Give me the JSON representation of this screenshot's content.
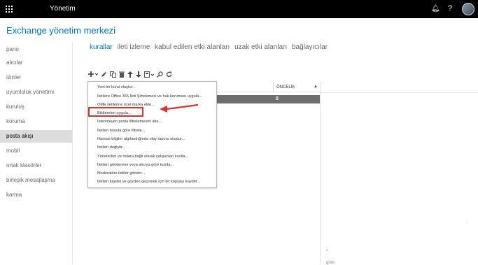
{
  "topbar": {
    "app_title": "Yönetim",
    "notifications_glyph": "🔔︎",
    "help_glyph": "?"
  },
  "center_title": "Exchange yönetim merkezi",
  "leftnav": {
    "items": [
      {
        "label": "pano"
      },
      {
        "label": "alıcılar"
      },
      {
        "label": "izinler"
      },
      {
        "label": "uyumluluk yönetimi"
      },
      {
        "label": "kuruluş"
      },
      {
        "label": "koruma"
      },
      {
        "label": "posta akışı",
        "active": true
      },
      {
        "label": "mobil"
      },
      {
        "label": "ortak klasörler"
      },
      {
        "label": "birleşik mesajlaşma"
      },
      {
        "label": "karma"
      }
    ]
  },
  "tabs": [
    {
      "label": "kurallar",
      "active": true
    },
    {
      "label": "ileti izleme"
    },
    {
      "label": "kabul edilen etki alanları"
    },
    {
      "label": "uzak etki alanları"
    },
    {
      "label": "bağlayıcılar"
    }
  ],
  "toolbar": {
    "icons": [
      "add-icon",
      "edit-icon",
      "copy-icon",
      "delete-icon",
      "move-up-icon",
      "move-down-icon",
      "export-icon",
      "search-icon",
      "refresh-icon"
    ]
  },
  "grid": {
    "column_priority": "ÖNCELİK",
    "selected_row_priority": "0"
  },
  "dropdown": {
    "items": [
      "Yeni bir kural oluştur...",
      "İletilere Office 365 İleti Şifrelemesi ve hak koruması uygula...",
      "OME iletilerine özel marka ekle...",
      "Bildirimleri uygula...",
      "İstenmeyen posta filtrelemesini atla...",
      "İletileri boyuta göre filtrele...",
      "Hassas bilgiler algılandığında olay raporu oluştur...",
      "İletileri değiştir...",
      "Yöneticileri ve onlara bağlı olarak çalışanları kısıtla...",
      "İletileri gönderene veya alıcıya göre kısıtla...",
      "Moderatöre iletiler gönder...",
      "İletileri kaydet ve gözden geçirmek için bir kopyayı kaydet..."
    ]
  },
  "detail": {
    "hint1": "* .",
    "hint2": "göre",
    "dot": "."
  },
  "colors": {
    "accent": "#0072c6",
    "highlight": "#d9342b",
    "topbar": "#000000"
  }
}
